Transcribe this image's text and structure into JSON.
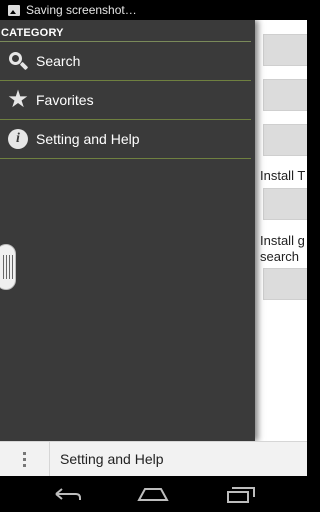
{
  "status_bar": {
    "notification_icon": "image-icon",
    "text": "Saving screenshot…"
  },
  "drawer": {
    "header": "CATEGORY",
    "items": [
      {
        "label": "Search",
        "icon": "search-icon"
      },
      {
        "label": "Favorites",
        "icon": "star-icon"
      },
      {
        "label": "Setting and Help",
        "icon": "info-icon"
      }
    ]
  },
  "main": {
    "label_install_t": "Install T",
    "label_install_g": "Install g",
    "label_search": "search"
  },
  "action_bar": {
    "title": "Setting and Help",
    "overflow_icon": "overflow-menu-icon"
  },
  "nav_bar": {
    "back_icon": "back-icon",
    "home_icon": "home-icon",
    "recents_icon": "recents-icon"
  },
  "colors": {
    "drawer_bg": "#3a3a3a",
    "divider": "#6f8040",
    "action_bar_bg": "#f2f2f2"
  }
}
